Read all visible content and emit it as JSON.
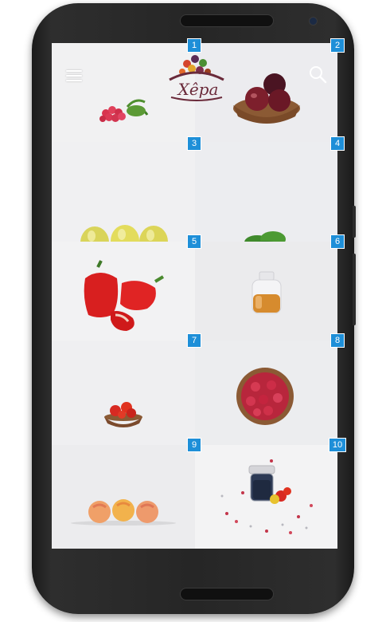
{
  "app": {
    "logo_text": "Xêpa"
  },
  "toolbar": {
    "menu_icon": "hamburger-menu-icon",
    "search_icon": "search-icon"
  },
  "tiles": [
    {
      "badge": "1",
      "item": "radishes"
    },
    {
      "badge": "2",
      "item": "plums-in-bowl"
    },
    {
      "badge": "3",
      "item": "yellow-apples"
    },
    {
      "badge": "4",
      "item": "basil"
    },
    {
      "badge": "5",
      "item": "red-peppers"
    },
    {
      "badge": "6",
      "item": "honey-jar"
    },
    {
      "badge": "7",
      "item": "cherry-tomatoes-bowl"
    },
    {
      "badge": "8",
      "item": "raspberries-bowl"
    },
    {
      "badge": "9",
      "item": "peaches"
    },
    {
      "badge": "10",
      "item": "jam-jar-and-tomatoes"
    }
  ],
  "colors": {
    "badge": "#1e8fd8",
    "logo": "#6a2a3a"
  }
}
